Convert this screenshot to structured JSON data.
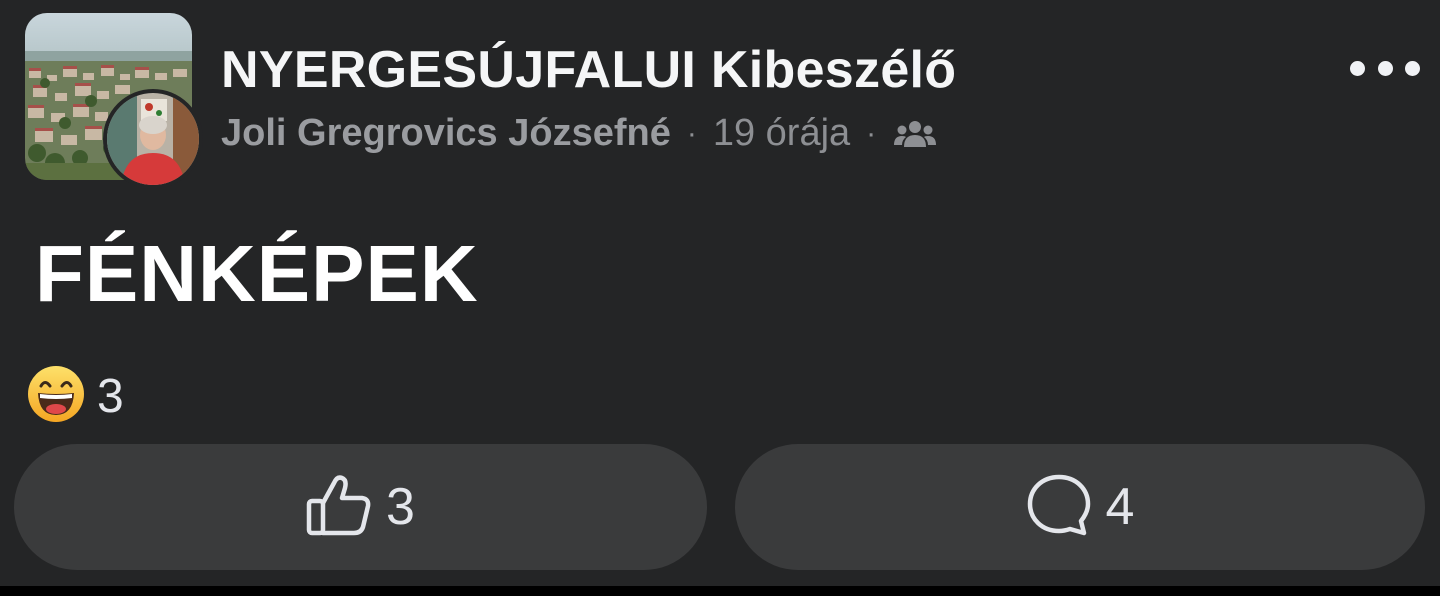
{
  "header": {
    "group_name": "NYERGESÚJFALUI Kibeszélő",
    "author": "Joli Gregrovics Józsefné",
    "separator": "·",
    "time": "19 órája",
    "audience_icon": "group-audience-icon",
    "more_icon": "more-options-icon"
  },
  "post": {
    "text": "FÉNKÉPEK"
  },
  "reactions": {
    "icon": "haha-emoji-icon",
    "count": "3"
  },
  "actions": {
    "like": {
      "icon": "thumbs-up-icon",
      "count": "3"
    },
    "comment": {
      "icon": "comment-bubble-icon",
      "count": "4"
    }
  },
  "colors": {
    "background": "#242526",
    "button_bg": "#3a3b3c",
    "primary_text": "#e4e6eb",
    "secondary_text": "#8d8f93",
    "emoji_yellow": "#f7b125"
  }
}
